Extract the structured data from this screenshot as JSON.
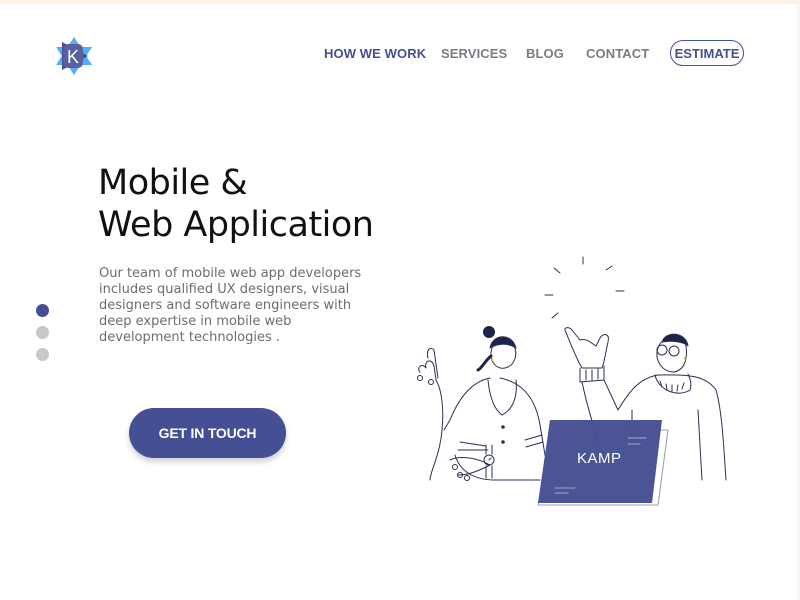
{
  "brand": {
    "logo_letter": "K",
    "colors": {
      "primary": "#454f93",
      "accent": "#3fa9f5",
      "text_dark": "#111111",
      "text_muted": "#6c6d73",
      "nav_inactive": "#7a7c85",
      "dot_inactive": "#c8c8c8"
    }
  },
  "nav": {
    "items": [
      {
        "label": "HOW WE WORK",
        "active": true
      },
      {
        "label": "SERVICES",
        "active": false
      },
      {
        "label": "BLOG",
        "active": false
      },
      {
        "label": "CONTACT",
        "active": false
      }
    ],
    "estimate_label": "ESTIMATE"
  },
  "hero": {
    "title_lines": [
      "Mobile &",
      "Web Application"
    ],
    "description_lines": [
      "Our team of mobile web app developers",
      "includes qualified UX designers, visual",
      "designers and software engineers with",
      "deep expertise in mobile web",
      "development technologies ."
    ],
    "cta_label": "GET IN TOUCH"
  },
  "slider": {
    "count": 3,
    "active_index": 0
  },
  "illustration": {
    "laptop_label": "KAMP"
  }
}
